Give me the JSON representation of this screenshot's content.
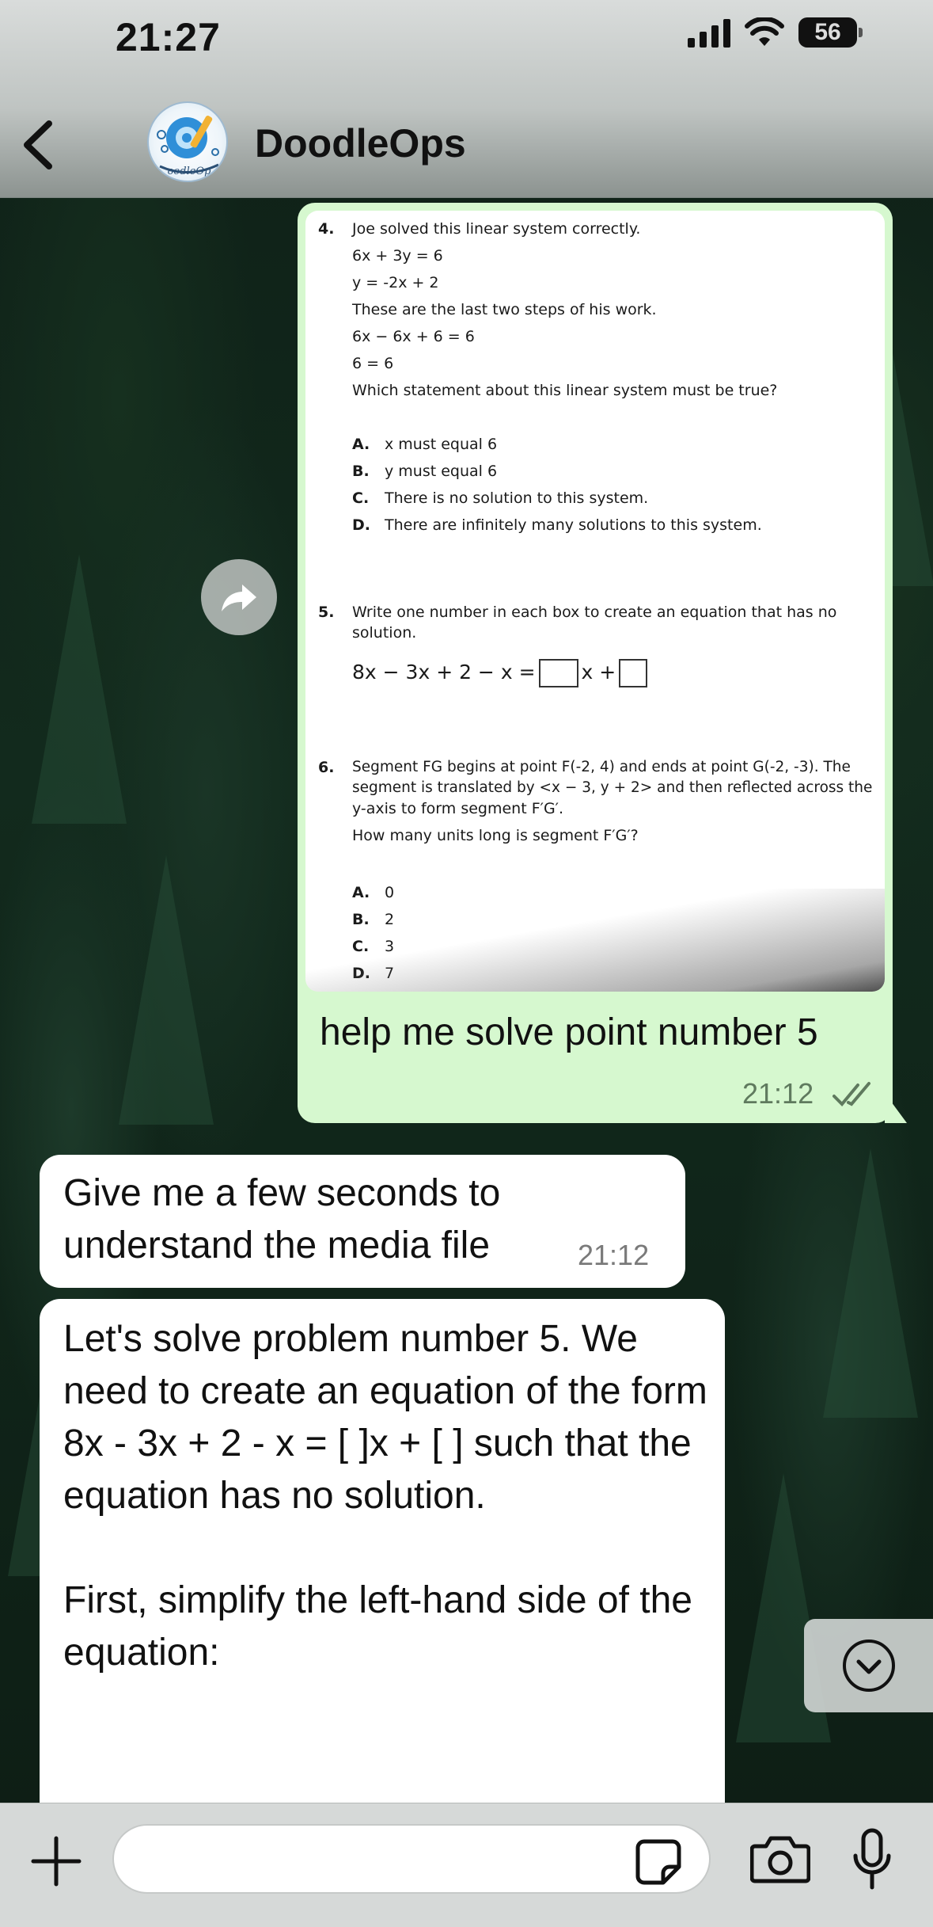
{
  "status_bar": {
    "time": "21:27",
    "battery": "56"
  },
  "header": {
    "contact_name": "DoodleOps",
    "avatar_text": "DoodleOps"
  },
  "outgoing": {
    "caption": "help me solve point number 5",
    "time": "21:12",
    "document": {
      "q4": {
        "num": "4.",
        "lines": [
          "Joe solved this linear system correctly.",
          "6x + 3y = 6",
          "y = -2x + 2",
          "These are the last two steps of his work.",
          "6x − 6x + 6 = 6",
          "6 = 6",
          "Which statement about this linear system must be true?"
        ],
        "options": [
          {
            "letter": "A.",
            "text": "x must equal 6"
          },
          {
            "letter": "B.",
            "text": "y must equal 6"
          },
          {
            "letter": "C.",
            "text": "There is no solution to this system."
          },
          {
            "letter": "D.",
            "text": "There are infinitely many solutions to this system."
          }
        ]
      },
      "q5": {
        "num": "5.",
        "line1": "Write one number in each box to create an equation that has no",
        "line2": "solution.",
        "equation_left": "8x − 3x + 2 − x =",
        "equation_mid": "x +"
      },
      "q6": {
        "num": "6.",
        "line1": "Segment FG begins at point F(-2, 4) and ends at point G(-2, -3). The",
        "line2": "segment is translated by <x − 3, y + 2> and then reflected across the",
        "line3": "y-axis to form segment F′G′.",
        "question": "How many units long is segment F′G′?",
        "options": [
          {
            "letter": "A.",
            "text": "0"
          },
          {
            "letter": "B.",
            "text": "2"
          },
          {
            "letter": "C.",
            "text": "3"
          },
          {
            "letter": "D.",
            "text": "7"
          }
        ]
      }
    }
  },
  "incoming": [
    {
      "text": "Give me a few seconds to understand the media file",
      "time": "21:12"
    },
    {
      "text": "Let's solve problem number 5. We need to create an equation of the form 8x - 3x + 2 - x = [ ]x + [ ] such that the equation has no solution.\n\nFirst, simplify the left-hand side of the equation:"
    }
  ],
  "composer": {
    "placeholder": ""
  },
  "icons": {
    "back": "chevron-left-icon",
    "forward": "share-arrow-icon",
    "scroll_down": "chevron-down-circle-icon",
    "plus": "plus-icon",
    "sticker": "sticker-icon",
    "camera": "camera-icon",
    "mic": "microphone-icon"
  },
  "colors": {
    "outgoing_bubble": "#d6f8cf",
    "incoming_bubble": "#ffffff",
    "read_ticks": "#5f7a5e"
  }
}
